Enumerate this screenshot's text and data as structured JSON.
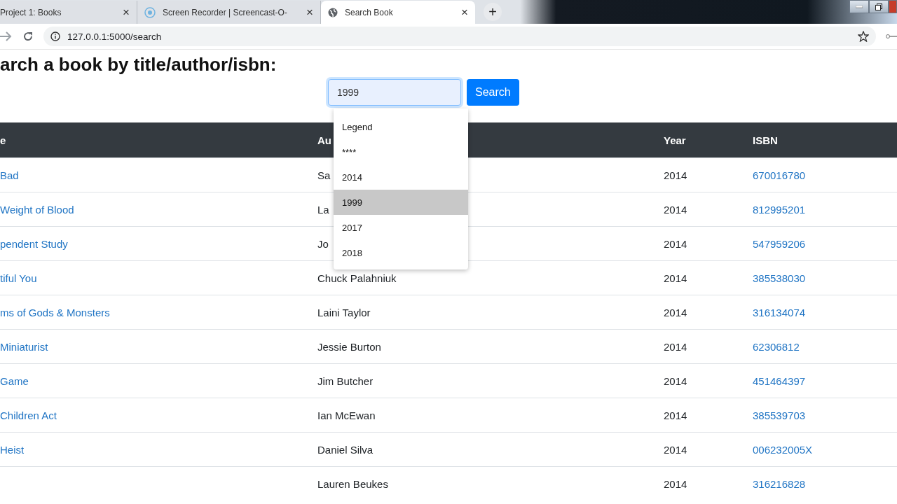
{
  "browser": {
    "tabs": [
      {
        "title": "Project 1: Books",
        "close": "×",
        "selected": false
      },
      {
        "title": "Screen Recorder | Screencast-O-",
        "close": "×",
        "selected": false
      },
      {
        "title": "Search Book",
        "close": "×",
        "selected": true
      }
    ],
    "new_tab": "+",
    "address": "127.0.0.1:5000/search"
  },
  "heading": "arch a book by title/author/isbn:",
  "search": {
    "value": "1999",
    "button": "Search",
    "suggestions": [
      {
        "label": "Legend",
        "selected": false
      },
      {
        "label": "****",
        "selected": false
      },
      {
        "label": "2014",
        "selected": false
      },
      {
        "label": "1999",
        "selected": true
      },
      {
        "label": "2017",
        "selected": false
      },
      {
        "label": "2018",
        "selected": false
      }
    ]
  },
  "table": {
    "columns": [
      "e",
      "Au",
      "Year",
      "ISBN"
    ],
    "rows": [
      {
        "title": "Bad",
        "author": "Sa",
        "year": "2014",
        "isbn": "670016780"
      },
      {
        "title": "Weight of Blood",
        "author": "La",
        "year": "2014",
        "isbn": "812995201"
      },
      {
        "title": "pendent Study",
        "author": "Jo",
        "year": "2014",
        "isbn": "547959206"
      },
      {
        "title": "tiful You",
        "author": "Chuck Palahniuk",
        "year": "2014",
        "isbn": "385538030"
      },
      {
        "title": "ms of Gods & Monsters",
        "author": "Laini Taylor",
        "year": "2014",
        "isbn": "316134074"
      },
      {
        "title": "Miniaturist",
        "author": "Jessie Burton",
        "year": "2014",
        "isbn": "62306812"
      },
      {
        "title": "Game",
        "author": "Jim Butcher",
        "year": "2014",
        "isbn": "451464397"
      },
      {
        "title": "Children Act",
        "author": "Ian McEwan",
        "year": "2014",
        "isbn": "385539703"
      },
      {
        "title": "Heist",
        "author": "Daniel Silva",
        "year": "2014",
        "isbn": "006232005X"
      },
      {
        "author": "Lauren Beukes",
        "year": "2014",
        "isbn": "316216828"
      }
    ]
  }
}
